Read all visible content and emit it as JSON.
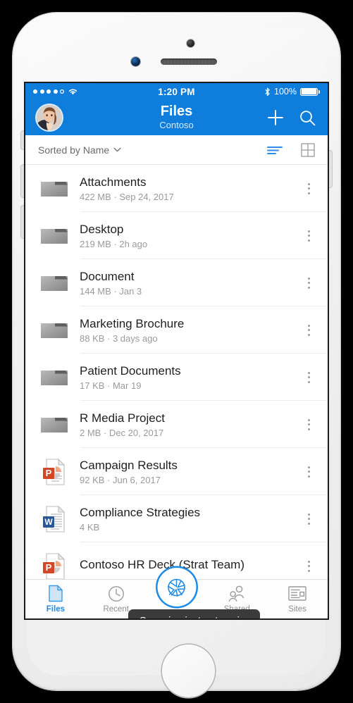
{
  "device": {
    "name": "white-iphone"
  },
  "status_bar": {
    "signal_dots_filled": 4,
    "signal_dots_total": 5,
    "wifi": "wifi-icon",
    "time": "1:20 PM",
    "bluetooth": "bluetooth-icon",
    "battery_percent": "100%",
    "battery_level": 100
  },
  "nav": {
    "title": "Files",
    "subtitle": "Contoso",
    "avatar": "user-avatar",
    "add_label": "+",
    "search_label": "search"
  },
  "sort_bar": {
    "sort_label": "Sorted by Name",
    "chevron": "chevron-down-icon",
    "list_view": "list-view-icon",
    "grid_view": "grid-view-icon",
    "active_view": "list"
  },
  "files": [
    {
      "name": "Attachments",
      "meta": "422 MB · Sep 24, 2017",
      "icon": "folder"
    },
    {
      "name": "Desktop",
      "meta": "219 MB · 2h ago",
      "icon": "folder"
    },
    {
      "name": "Document",
      "meta": "144 MB · Jan 3",
      "icon": "folder"
    },
    {
      "name": "Marketing Brochure",
      "meta": "88 KB · 3 days ago",
      "icon": "folder"
    },
    {
      "name": "Patient Documents",
      "meta": "17 KB · Mar 19",
      "icon": "folder"
    },
    {
      "name": "R Media Project",
      "meta": "2 MB · Dec 20, 2017",
      "icon": "folder"
    },
    {
      "name": "Campaign Results",
      "meta": "92 KB · Jun 6, 2017",
      "icon": "powerpoint"
    },
    {
      "name": "Compliance Strategies",
      "meta": "4 KB",
      "icon": "word"
    },
    {
      "name": "Contoso HR Deck (Strat Team)",
      "meta": "",
      "icon": "powerpoint"
    }
  ],
  "tooltip": {
    "text": "Scanning just got easier"
  },
  "tabs": [
    {
      "label": "Files",
      "icon": "file-page-icon",
      "active": true
    },
    {
      "label": "Recent",
      "icon": "clock-icon",
      "active": false
    },
    {
      "label": "Shared",
      "icon": "people-icon",
      "active": false
    },
    {
      "label": "Sites",
      "icon": "sites-icon",
      "active": false
    }
  ],
  "scan_button": {
    "icon": "camera-aperture-icon"
  },
  "colors": {
    "brand_blue": "#0f7ddb",
    "accent_blue": "#1d8ae8",
    "tooltip_bg": "#3b3b3b",
    "word_blue": "#2b579a",
    "powerpoint_orange": "#d24726"
  }
}
